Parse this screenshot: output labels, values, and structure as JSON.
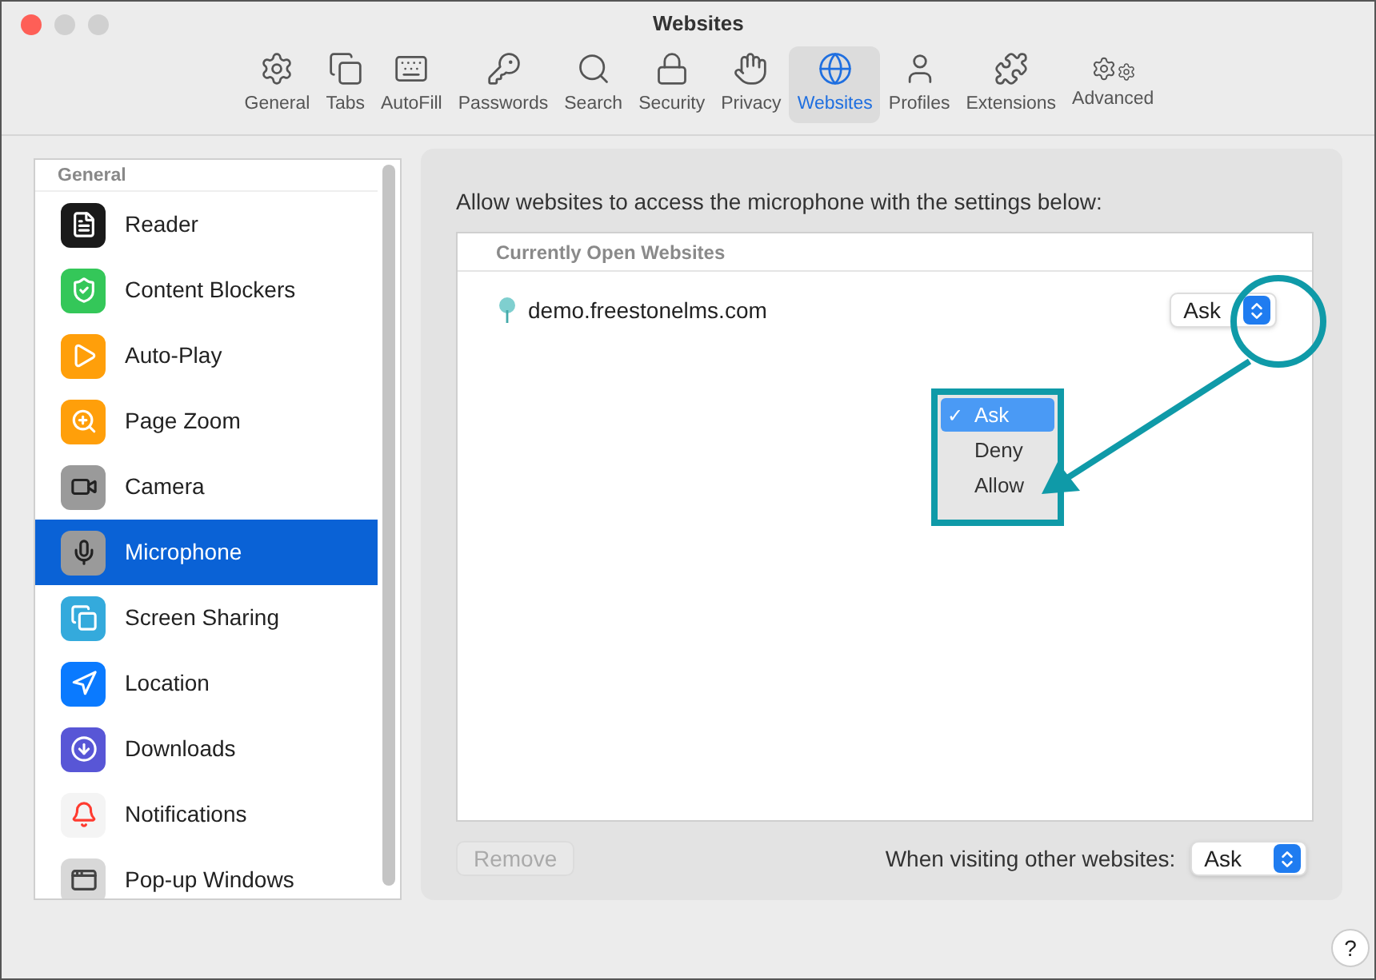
{
  "window": {
    "title": "Websites"
  },
  "toolbar": {
    "items": [
      {
        "label": "General",
        "selected": false
      },
      {
        "label": "Tabs",
        "selected": false
      },
      {
        "label": "AutoFill",
        "selected": false
      },
      {
        "label": "Passwords",
        "selected": false
      },
      {
        "label": "Search",
        "selected": false
      },
      {
        "label": "Security",
        "selected": false
      },
      {
        "label": "Privacy",
        "selected": false
      },
      {
        "label": "Websites",
        "selected": true
      },
      {
        "label": "Profiles",
        "selected": false
      },
      {
        "label": "Extensions",
        "selected": false
      },
      {
        "label": "Advanced",
        "selected": false
      }
    ]
  },
  "sidebar": {
    "section": "General",
    "items": [
      {
        "label": "Reader",
        "selected": false
      },
      {
        "label": "Content Blockers",
        "selected": false
      },
      {
        "label": "Auto-Play",
        "selected": false
      },
      {
        "label": "Page Zoom",
        "selected": false
      },
      {
        "label": "Camera",
        "selected": false
      },
      {
        "label": "Microphone",
        "selected": true
      },
      {
        "label": "Screen Sharing",
        "selected": false
      },
      {
        "label": "Location",
        "selected": false
      },
      {
        "label": "Downloads",
        "selected": false
      },
      {
        "label": "Notifications",
        "selected": false
      },
      {
        "label": "Pop-up Windows",
        "selected": false
      }
    ]
  },
  "panel": {
    "description": "Allow websites to access the microphone with the settings below:",
    "table_header": "Currently Open Websites",
    "sites": [
      {
        "name": "demo.freestonelms.com",
        "value": "Ask"
      }
    ],
    "menu": {
      "items": [
        {
          "label": "Ask",
          "selected": true,
          "check": "✓"
        },
        {
          "label": "Deny",
          "selected": false
        },
        {
          "label": "Allow",
          "selected": false
        }
      ]
    },
    "remove_button": {
      "label": "Remove",
      "disabled": true
    },
    "other_label": "When visiting other websites:",
    "other_value": "Ask"
  },
  "help": "?"
}
